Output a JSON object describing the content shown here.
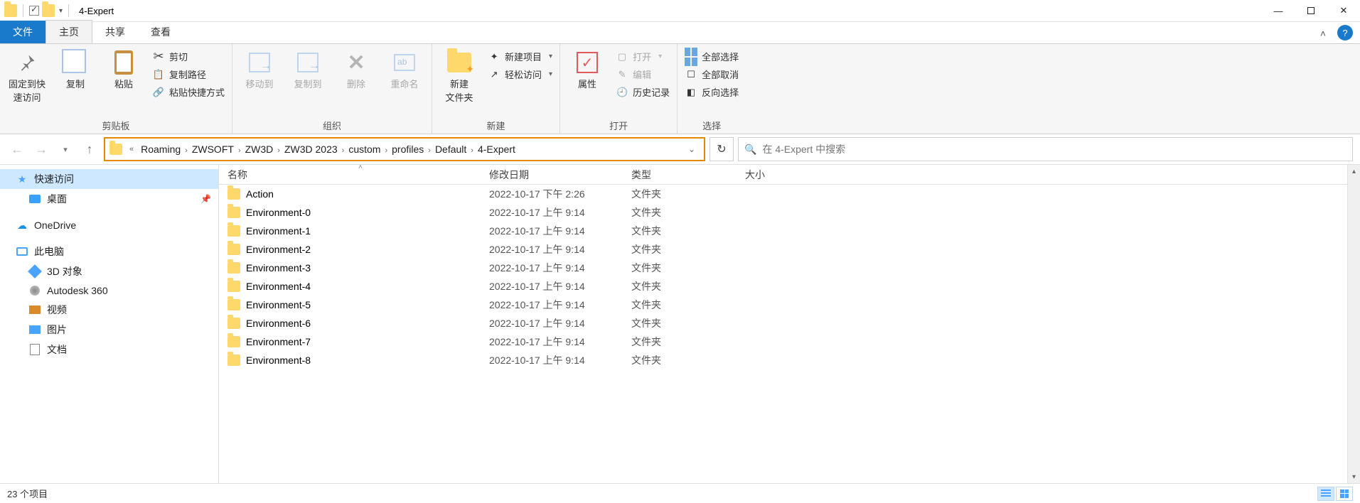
{
  "title": "4-Expert",
  "tabs": {
    "file": "文件",
    "home": "主页",
    "share": "共享",
    "view": "查看"
  },
  "ribbon": {
    "clipboard": {
      "label": "剪贴板",
      "pin": "固定到快\n速访问",
      "copy": "复制",
      "paste": "粘贴",
      "cut": "剪切",
      "copy_path": "复制路径",
      "paste_shortcut": "粘贴快捷方式"
    },
    "organize": {
      "label": "组织",
      "move_to": "移动到",
      "copy_to": "复制到",
      "delete": "删除",
      "rename": "重命名"
    },
    "new": {
      "label": "新建",
      "new_folder": "新建\n文件夹",
      "new_item": "新建项目",
      "easy_access": "轻松访问"
    },
    "open": {
      "label": "打开",
      "properties": "属性",
      "open": "打开",
      "edit": "编辑",
      "history": "历史记录"
    },
    "select": {
      "label": "选择",
      "select_all": "全部选择",
      "select_none": "全部取消",
      "invert": "反向选择"
    }
  },
  "breadcrumb": [
    "Roaming",
    "ZWSOFT",
    "ZW3D",
    "ZW3D 2023",
    "custom",
    "profiles",
    "Default",
    "4-Expert"
  ],
  "search_placeholder": "在 4-Expert 中搜索",
  "sidebar": {
    "quick_access": "快速访问",
    "desktop": "桌面",
    "onedrive": "OneDrive",
    "this_pc": "此电脑",
    "three_d": "3D 对象",
    "autodesk": "Autodesk 360",
    "videos": "视频",
    "pictures": "图片",
    "documents": "文档"
  },
  "columns": {
    "name": "名称",
    "date": "修改日期",
    "type": "类型",
    "size": "大小"
  },
  "rows": [
    {
      "name": "Action",
      "date": "2022-10-17 下午 2:26",
      "type": "文件夹"
    },
    {
      "name": "Environment-0",
      "date": "2022-10-17 上午 9:14",
      "type": "文件夹"
    },
    {
      "name": "Environment-1",
      "date": "2022-10-17 上午 9:14",
      "type": "文件夹"
    },
    {
      "name": "Environment-2",
      "date": "2022-10-17 上午 9:14",
      "type": "文件夹"
    },
    {
      "name": "Environment-3",
      "date": "2022-10-17 上午 9:14",
      "type": "文件夹"
    },
    {
      "name": "Environment-4",
      "date": "2022-10-17 上午 9:14",
      "type": "文件夹"
    },
    {
      "name": "Environment-5",
      "date": "2022-10-17 上午 9:14",
      "type": "文件夹"
    },
    {
      "name": "Environment-6",
      "date": "2022-10-17 上午 9:14",
      "type": "文件夹"
    },
    {
      "name": "Environment-7",
      "date": "2022-10-17 上午 9:14",
      "type": "文件夹"
    },
    {
      "name": "Environment-8",
      "date": "2022-10-17 上午 9:14",
      "type": "文件夹"
    }
  ],
  "status": "23 个项目"
}
